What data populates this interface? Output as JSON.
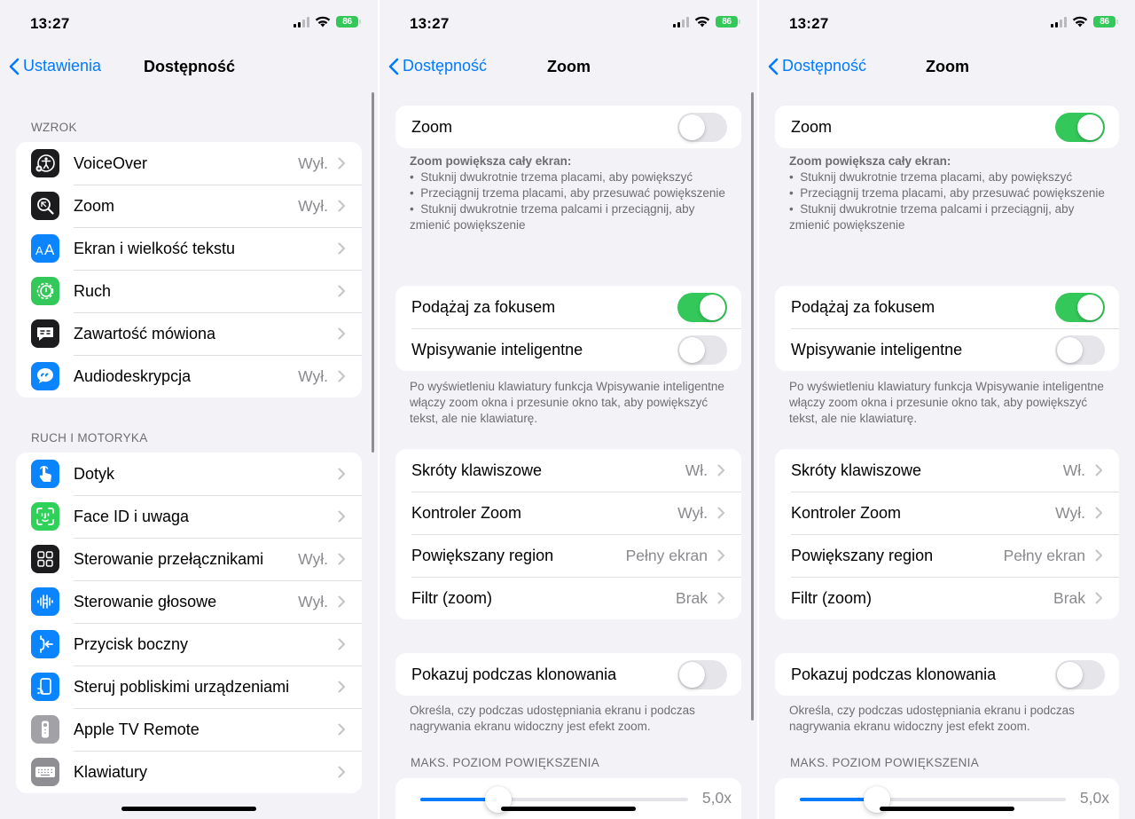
{
  "status": {
    "time": "13:27",
    "battery": "86"
  },
  "colors": {
    "accent": "#007aff",
    "toggle_on": "#34c759"
  },
  "screen1": {
    "back_label": "Ustawienia",
    "title": "Dostępność",
    "sections": [
      {
        "header": "WZROK",
        "items": [
          {
            "label": "VoiceOver",
            "value": "Wył.",
            "icon": "voiceover-icon"
          },
          {
            "label": "Zoom",
            "value": "Wył.",
            "icon": "zoom-icon"
          },
          {
            "label": "Ekran i wielkość tekstu",
            "value": "",
            "icon": "text-size-icon"
          },
          {
            "label": "Ruch",
            "value": "",
            "icon": "motion-icon"
          },
          {
            "label": "Zawartość mówiona",
            "value": "",
            "icon": "spoken-content-icon"
          },
          {
            "label": "Audiodeskrypcja",
            "value": "Wył.",
            "icon": "audio-description-icon"
          }
        ]
      },
      {
        "header": "RUCH I MOTORYKA",
        "items": [
          {
            "label": "Dotyk",
            "value": "",
            "icon": "touch-icon"
          },
          {
            "label": "Face ID i uwaga",
            "value": "",
            "icon": "face-id-icon"
          },
          {
            "label": "Sterowanie przełącznikami",
            "value": "Wył.",
            "icon": "switch-control-icon"
          },
          {
            "label": "Sterowanie głosowe",
            "value": "Wył.",
            "icon": "voice-control-icon"
          },
          {
            "label": "Przycisk boczny",
            "value": "",
            "icon": "side-button-icon"
          },
          {
            "label": "Steruj pobliskimi urządzeniami",
            "value": "",
            "icon": "nearby-devices-icon"
          },
          {
            "label": "Apple TV Remote",
            "value": "",
            "icon": "tv-remote-icon"
          },
          {
            "label": "Klawiatury",
            "value": "",
            "icon": "keyboard-icon"
          }
        ]
      }
    ]
  },
  "zoom_screen": {
    "back_label": "Dostępność",
    "title": "Zoom",
    "zoom_label": "Zoom",
    "zoom_desc": {
      "title": "Zoom powiększa cały ekran:",
      "bullets": [
        "Stuknij dwukrotnie trzema placami, aby powiększyć",
        "Przeciągnij trzema placami, aby przesuwać powiększenie",
        "Stuknij dwukrotnie trzema palcami i przeciągnij, aby zmienić powiększenie"
      ]
    },
    "follow_focus": "Podążaj za fokusem",
    "smart_typing": "Wpisywanie inteligentne",
    "smart_typing_desc": "Po wyświetleniu klawiatury funkcja Wpisywanie inteligentne włączy zoom okna i przesunie okno tak, aby powiększyć tekst, ale nie klawiaturę.",
    "options": [
      {
        "label": "Skróty klawiszowe",
        "value": "Wł."
      },
      {
        "label": "Kontroler Zoom",
        "value": "Wył."
      },
      {
        "label": "Powiększany region",
        "value": "Pełny ekran"
      },
      {
        "label": "Filtr (zoom)",
        "value": "Brak"
      }
    ],
    "mirroring": "Pokazuj podczas klonowania",
    "mirroring_desc": "Określa, czy podczas udostępniania ekranu i podczas nagrywania ekranu widoczny jest efekt zoom.",
    "max_zoom_header": "MAKS. POZIOM POWIĘKSZENIA",
    "max_zoom_value": "5,0x",
    "max_zoom_fraction": 0.29
  },
  "screen2_toggles": {
    "zoom": false,
    "follow_focus": true,
    "smart_typing": false,
    "mirroring": false
  },
  "screen3_toggles": {
    "zoom": true,
    "follow_focus": true,
    "smart_typing": false,
    "mirroring": false
  }
}
